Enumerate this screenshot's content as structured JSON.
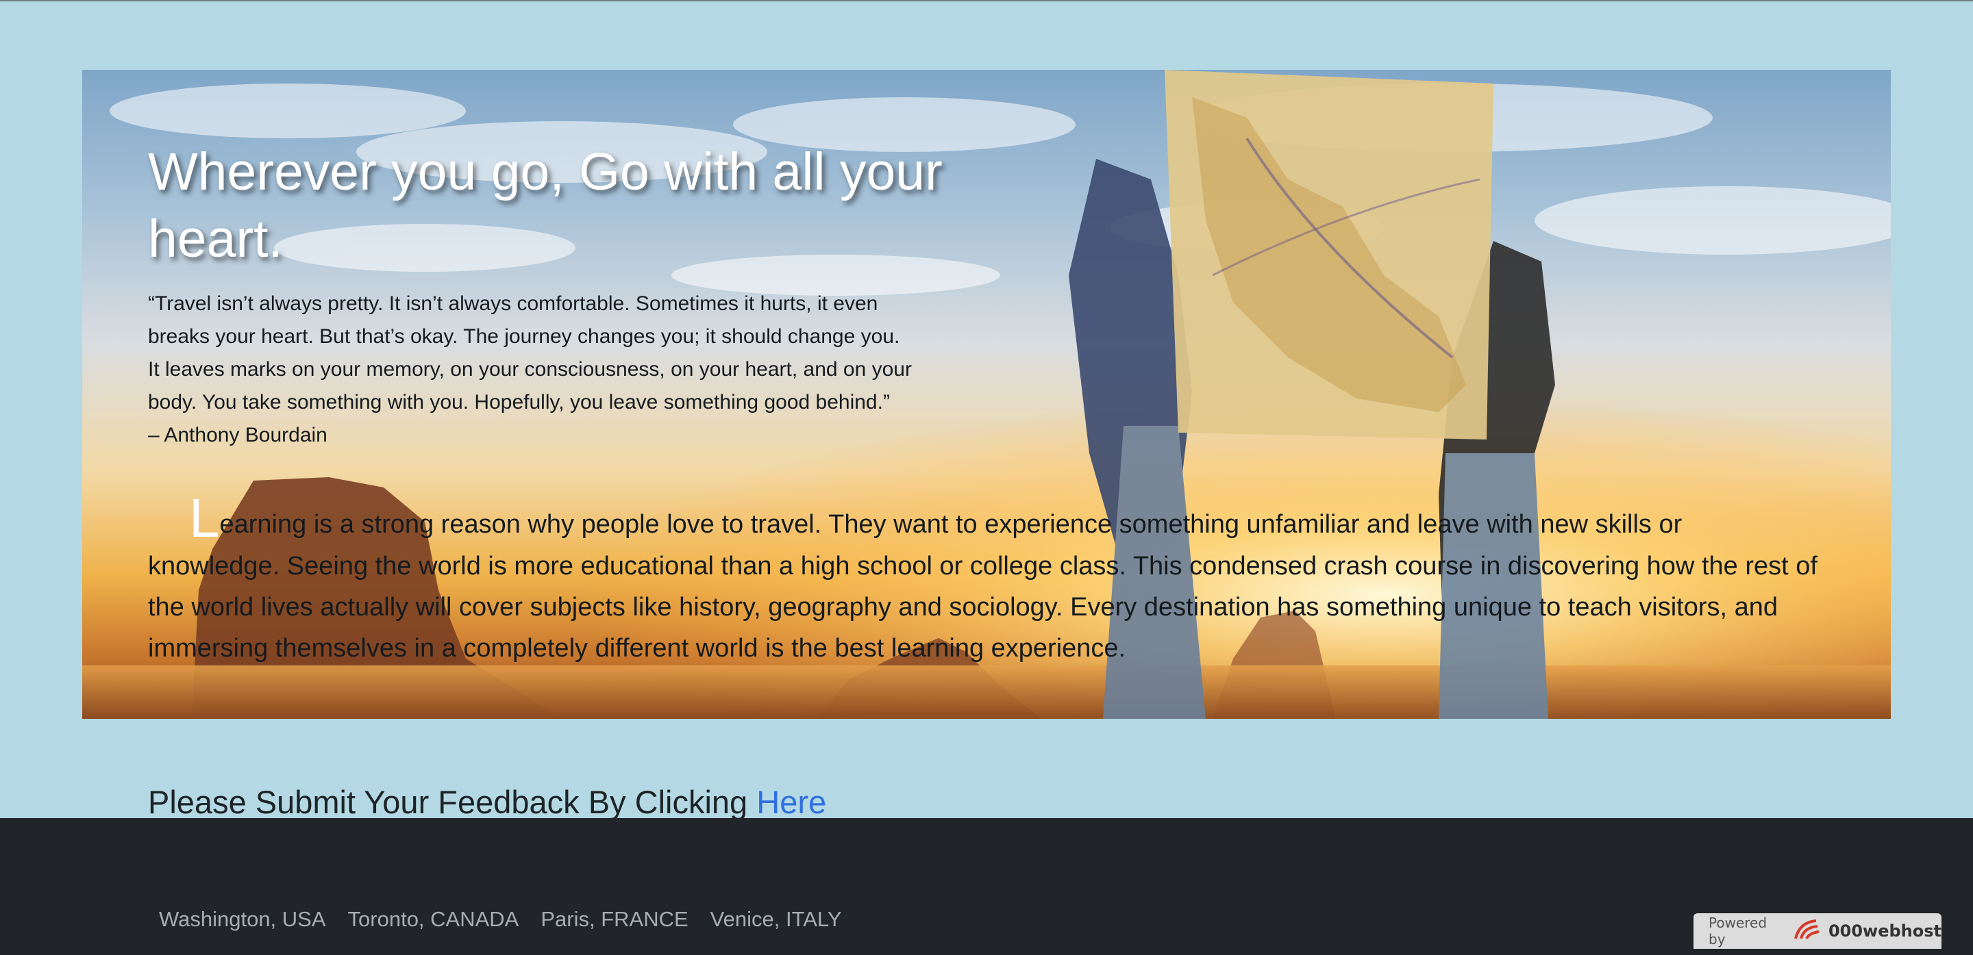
{
  "hero": {
    "title": "Wherever you go, Go with all your heart.",
    "quote_lines": [
      "“Travel isn’t always pretty. It isn’t always comfortable. Sometimes it hurts, it even",
      "breaks your heart. But that’s okay. The journey changes you; it should change you.",
      "It leaves marks on your memory, on your consciousness, on your heart, and on your",
      "body. You take something with you. Hopefully, you leave something good behind.”",
      "– Anthony Bourdain"
    ],
    "article_dropcap": "L",
    "article_first": "earning is a strong reason why people love to travel. They want to experience something unfamiliar and leave with new skills or",
    "article_rest": "knowledge. Seeing the world is more educational than a high school or college class. This condensed crash course in discovering how the rest of the world lives actually will cover subjects like history, geography and sociology. Every destination has something unique to teach visitors, and immersing themselves in a completely different world is the best learning experience."
  },
  "feedback": {
    "text": "Please Submit Your Feedback By Clicking ",
    "link_label": "Here"
  },
  "footer": {
    "links": [
      "Washington, USA",
      "Toronto, CANADA",
      "Paris, FRANCE",
      "Venice, ITALY"
    ]
  },
  "badge": {
    "label": "Powered by",
    "brand": "000webhost"
  },
  "colors": {
    "page_bg": "#b4d9e4",
    "footer_bg": "#212529",
    "link": "#2f6fe0"
  }
}
